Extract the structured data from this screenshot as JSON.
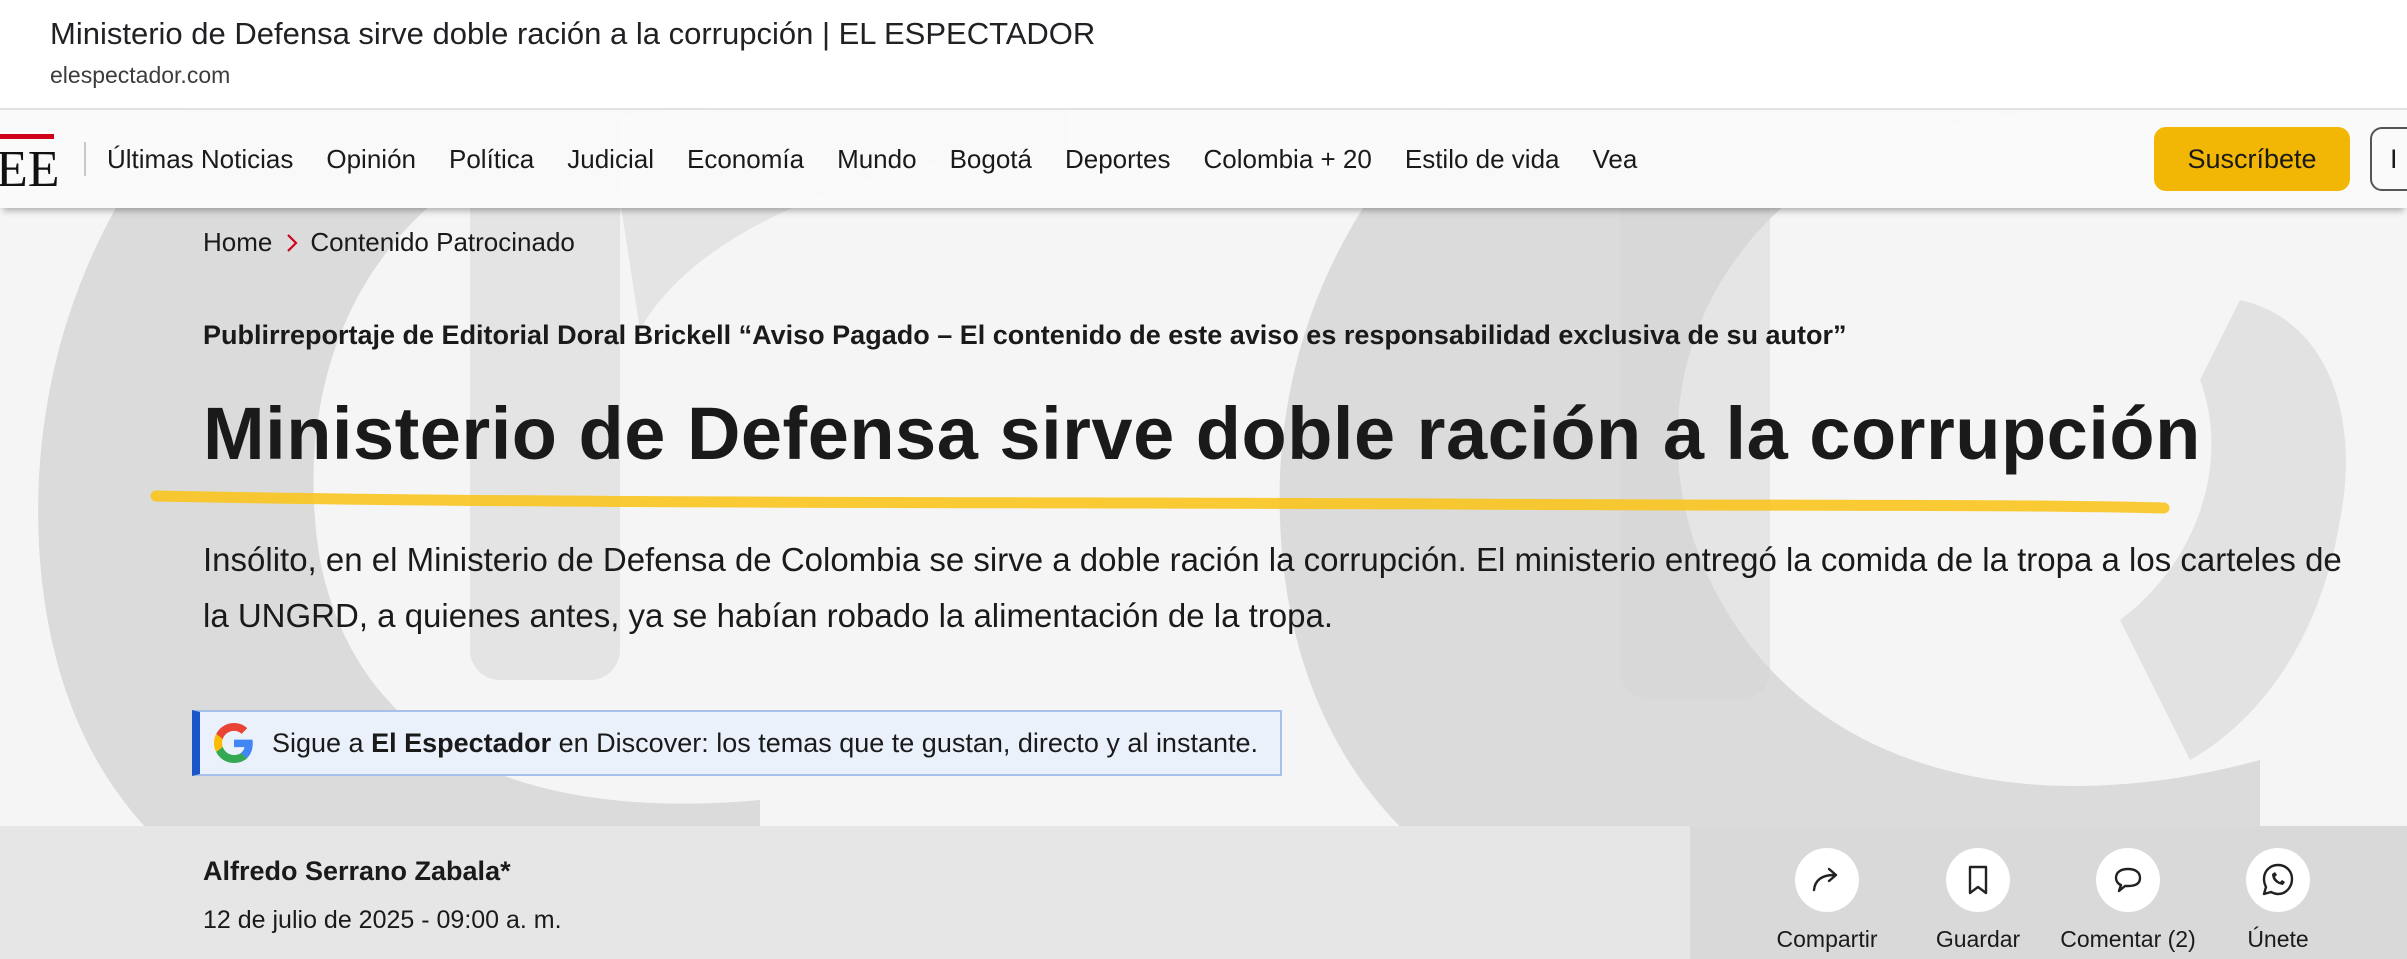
{
  "browser": {
    "page_title": "Ministerio de Defensa sirve doble ración a la corrupción | EL ESPECTADOR",
    "domain": "elespectador.com"
  },
  "nav": {
    "logo_text": "EE",
    "items": [
      "Últimas Noticias",
      "Opinión",
      "Política",
      "Judicial",
      "Economía",
      "Mundo",
      "Bogotá",
      "Deportes",
      "Colombia + 20",
      "Estilo de vida",
      "Vea"
    ],
    "subscribe_label": "Suscríbete",
    "login_label": "I"
  },
  "breadcrumb": {
    "home": "Home",
    "section": "Contenido Patrocinado"
  },
  "article": {
    "kicker": "Publirreportaje de Editorial Doral Brickell “Aviso Pagado – El contenido de este aviso es responsabilidad exclusiva de su autor”",
    "headline": "Ministerio de Defensa sirve doble ración a la corrupción",
    "lead": "Insólito, en el Ministerio de Defensa de Colombia se sirve a doble ración la corrupción. El ministerio entregó la comida de la tropa a los carteles de la UNGRD, a quienes antes, ya se habían robado la alimentación de la tropa.",
    "author": "Alfredo Serrano Zabala*",
    "date": "12 de julio de 2025 - 09:00 a. m."
  },
  "discover": {
    "prefix": "Sigue a ",
    "brand": "El Espectador",
    "suffix": " en Discover: los temas que te gustan, directo y al instante."
  },
  "actions": {
    "share": "Compartir",
    "save": "Guardar",
    "comment": "Comentar (2)",
    "join": "Únete"
  },
  "colors": {
    "accent_yellow": "#f2b705",
    "highlight_underline": "#f9c623",
    "discover_blue": "#1a56c9",
    "logo_red": "#d0021b"
  },
  "icons": [
    "share-icon",
    "bookmark-icon",
    "comment-icon",
    "whatsapp-icon",
    "google-icon",
    "chevron-right-icon",
    "watermark-logo"
  ]
}
